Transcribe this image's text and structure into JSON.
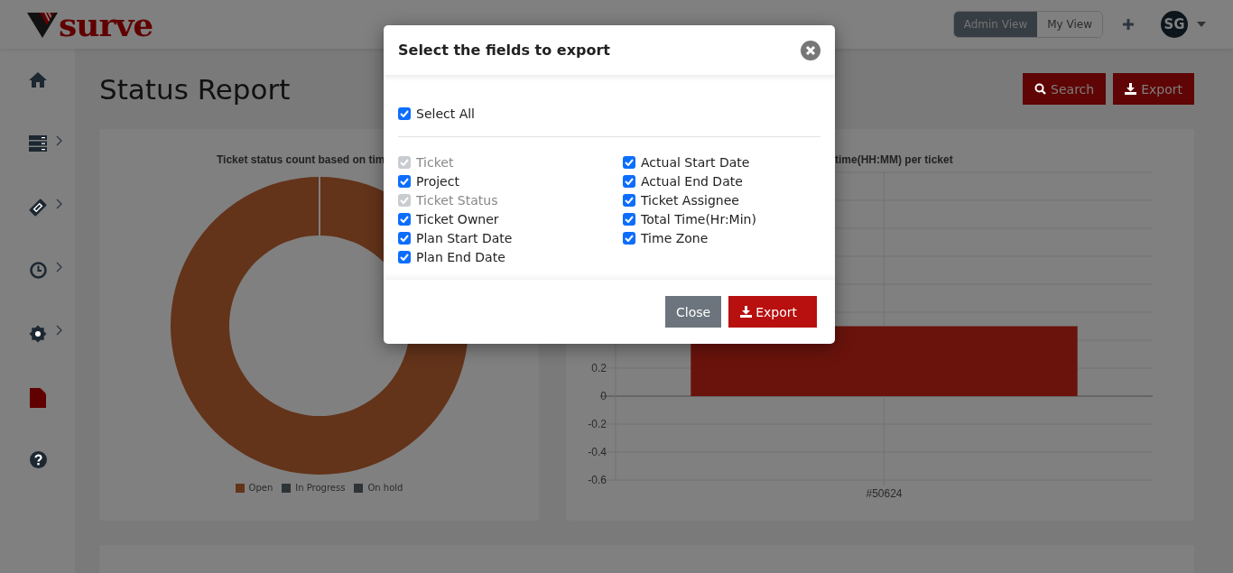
{
  "header": {
    "logo": "surve",
    "views": [
      {
        "label": "Admin View",
        "selected": true
      },
      {
        "label": "My View",
        "selected": false
      }
    ],
    "avatar": "SG"
  },
  "sidebar": {
    "items": [
      {
        "kind": "home",
        "expandable": false,
        "selected": false
      },
      {
        "kind": "server",
        "expandable": true,
        "selected": false
      },
      {
        "kind": "ticket",
        "expandable": true,
        "selected": false
      },
      {
        "kind": "clock",
        "expandable": true,
        "selected": false
      },
      {
        "kind": "gear",
        "expandable": true,
        "selected": false
      },
      {
        "kind": "file",
        "expandable": false,
        "selected": true
      },
      {
        "kind": "help",
        "expandable": false,
        "selected": false
      }
    ]
  },
  "page": {
    "title": "Status Report",
    "buttons": [
      {
        "label": "Search",
        "kind": "search"
      },
      {
        "label": "Export",
        "kind": "export"
      }
    ]
  },
  "status_chart": {
    "title": "Ticket status count based on  tim",
    "chart_data": {
      "type": "pie",
      "categories": [
        "Open",
        "In Progress",
        "On hold"
      ],
      "values": [
        1,
        0,
        0
      ],
      "colors": [
        "#63331a",
        "#2e3338",
        "#2e3338"
      ]
    }
  },
  "time_chart": {
    "title": "time(HH:MM) per ticket",
    "chart_data": {
      "type": "bar",
      "categories": [
        "#50624"
      ],
      "series": [
        {
          "color": "#6a130c",
          "values": [
            0.5
          ]
        }
      ],
      "ylim": [
        -0.6,
        1.6
      ],
      "yticks": [
        -0.6,
        -0.4,
        -0.2,
        0,
        0.2
      ],
      "grid": true
    }
  },
  "modal": {
    "title": "Select the fields to export",
    "select_all": {
      "label": "Select All",
      "checked": true
    },
    "fields": [
      {
        "label": "Ticket",
        "checked": true,
        "disabled": true
      },
      {
        "label": "Project",
        "checked": true,
        "disabled": false
      },
      {
        "label": "Ticket Status",
        "checked": true,
        "disabled": true
      },
      {
        "label": "Ticket Owner",
        "checked": true,
        "disabled": false
      },
      {
        "label": "Plan Start Date",
        "checked": true,
        "disabled": false
      },
      {
        "label": "Plan End Date",
        "checked": true,
        "disabled": false
      },
      {
        "label": "Actual Start Date",
        "checked": true,
        "disabled": false
      },
      {
        "label": "Actual End Date",
        "checked": true,
        "disabled": false
      },
      {
        "label": "Ticket Assignee",
        "checked": true,
        "disabled": false
      },
      {
        "label": "Total Time(Hr:Min)",
        "checked": true,
        "disabled": false
      },
      {
        "label": "Time Zone",
        "checked": true,
        "disabled": false
      }
    ],
    "buttons": [
      {
        "label": "Close",
        "kind": "close"
      },
      {
        "label": "Export",
        "kind": "export"
      }
    ]
  }
}
